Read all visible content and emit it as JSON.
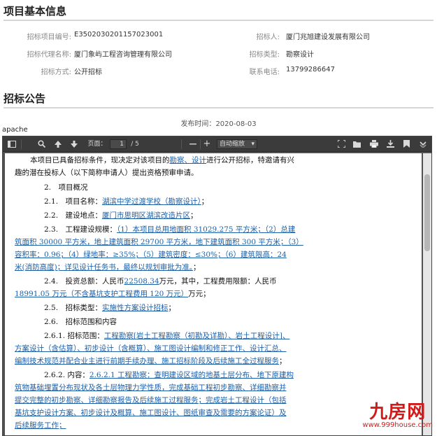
{
  "section1": {
    "title": "项目基本信息"
  },
  "info": [
    {
      "label": "招标项目编号:",
      "value": "E3502030201157023001"
    },
    {
      "label": "招标人:",
      "value": "厦门兆旭建设发展有限公司"
    },
    {
      "label": "招标代理名称:",
      "value": "厦门象屿工程咨询管理有限公司"
    },
    {
      "label": "招标类型:",
      "value": "勘察设计"
    },
    {
      "label": "招标方式:",
      "value": "公开招标"
    },
    {
      "label": "联系电话:",
      "value": "13799286647"
    }
  ],
  "section2": {
    "title": "招标公告"
  },
  "publish": {
    "label": "发布时间：",
    "date": "2020-08-03"
  },
  "apache": "apache",
  "toolbar": {
    "page_label": "页面：",
    "page_current": "1",
    "page_total": "/ 5",
    "zoom_minus": "—",
    "zoom_plus": "+",
    "zoom_value": "自动缩放"
  },
  "doc": {
    "l1a": "本项目已具备招标条件，现决定对该项目的",
    "l1b": "勘察、设计",
    "l1c": "进行公开招标，特邀请有兴",
    "l2": "趣的潜在投标人（以下简称申请人）提出资格预审申请。",
    "l3": "2.　项目概况",
    "l4a": "2.1.　项目名称：",
    "l4b": "湖滨中学过渡学校（勘察设计）",
    "l4c": "；",
    "l5a": "2.2.　建设地点：",
    "l5b": "厦门市思明区湖滨改造片区",
    "l5c": "；",
    "l6a": "2.3.　工程建设规模：",
    "l6b": "（1）本项目总用地面积 31029.275 平方米；（2）总建",
    "l7": "筑面积 30000 平方米，地上建筑面积 29700 平方米，地下建筑面积 300 平方米；（3）",
    "l8": "容积率：0.96；（4）绿地率：≥35%；（5）建筑密度：≤30%；（6）建筑限高：24",
    "l9a": "米(消防高度)；详见设计任务书，最终以规划审批为准。",
    "l9b": "；",
    "l10a": "2.4.　投资总额：人民币",
    "l10b": "22508.34",
    "l10c": "万元，其中，工程费用限额：人民币",
    "l11a": "18991.05 万元（不含基坑支护工程费用 120 万元）",
    "l11b": "万元；",
    "l12a": "2.5.　招标类型：",
    "l12b": "实施性方案设计招标",
    "l12c": "；",
    "l13": "2.6.　招标范围和内容",
    "l14a": "2.6.1. 招标范围：",
    "l14b": "工程勘察[岩土工程勘察（初勘及详勘）、岩土工程设计]、",
    "l15": "方案设计（含估算）、初步设计（含概算）、施工图设计编制和修正工作、设计汇总、",
    "l16": "编制技术规范并配合业主进行前期手续办理、施工招标阶段及后续施工全过程服务",
    "l16b": "；",
    "l17a": "2.6.2. 内容：",
    "l17b": "2.6.2.1 工程勘察：查明建设区域的地基土层分布、地下原建构",
    "l18": "筑物基础埋置分布现状及各土层物理力学性质，完成基础工程初步勘察、详细勘察并",
    "l19": "提交完整的初步勘察、详细勘察报告及后续施工过程服务；完成岩土工程设计（包括",
    "l20": "基坑支护设计方案、初步设计及概算、施工图设计、图纸审查及需要的方案论证）及",
    "l21": "后续服务工作；"
  },
  "watermark": {
    "logo": "九房网",
    "url": "www.999house.com"
  }
}
